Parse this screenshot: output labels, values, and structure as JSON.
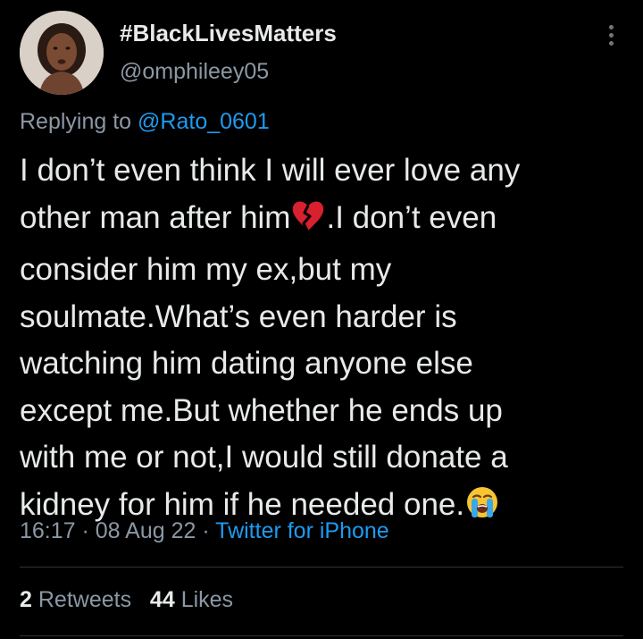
{
  "colors": {
    "background": "#000000",
    "text_primary": "#e7e9ea",
    "text_secondary": "#8b98a5",
    "link": "#1d9bf0",
    "divider": "#2f3336"
  },
  "author": {
    "display_name": "#BlackLivesMatters",
    "username": "@omphileey05",
    "avatar_icon": "profile-photo"
  },
  "reply": {
    "prefix": "Replying to",
    "handle": "@Rato_0601"
  },
  "tweet": {
    "lines": [
      "I don’t even think I will ever love any",
      "other man after him",
      ".I don’t even",
      "consider him my ex,but my",
      "soulmate.What’s even harder is",
      "watching him dating anyone else",
      "except me.But whether he ends up",
      "with me or not,I would still donate a",
      "kidney for him if he needed one."
    ],
    "emojis": [
      "broken-heart-icon",
      "loudly-crying-face-icon"
    ]
  },
  "meta": {
    "time": "16:17",
    "separator": " · ",
    "date": "08 Aug 22",
    "source": "Twitter for iPhone"
  },
  "stats": {
    "retweets_count": "2",
    "retweets_label": "Retweets",
    "likes_count": "44",
    "likes_label": "Likes"
  },
  "more_icon": "more-options-icon"
}
